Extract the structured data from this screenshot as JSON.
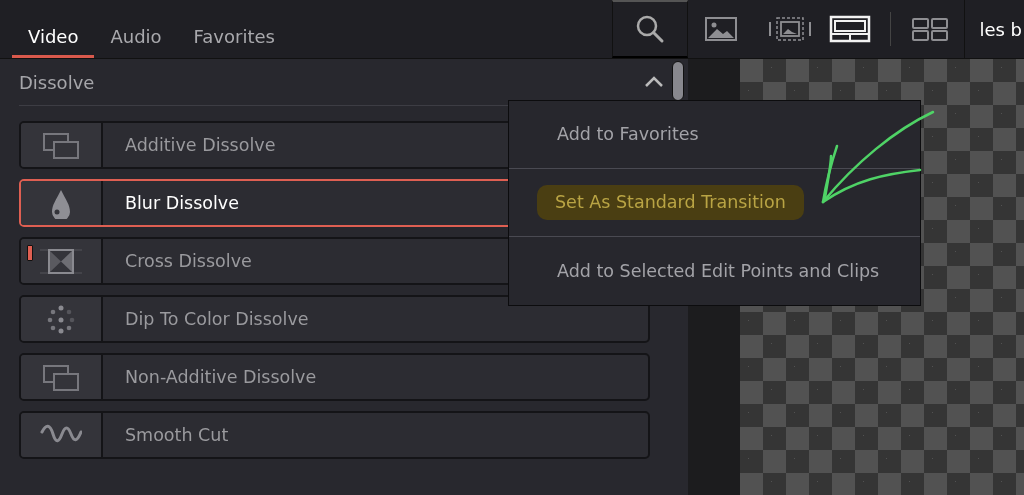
{
  "tabs": [
    {
      "label": "Video",
      "selected": true
    },
    {
      "label": "Audio",
      "selected": false
    },
    {
      "label": "Favorites",
      "selected": false
    }
  ],
  "view_toolbar": {
    "buttons": [
      {
        "kind": "image",
        "selected": false
      },
      {
        "kind": "image-strip",
        "selected": false
      },
      {
        "kind": "grid",
        "selected": true
      },
      {
        "kind": "tiles",
        "selected": false
      }
    ],
    "title": "les b"
  },
  "section": {
    "title": "Dissolve",
    "expanded": true
  },
  "transitions": [
    {
      "name": "Additive Dissolve",
      "kind": "overlap",
      "selected": false,
      "standard": false
    },
    {
      "name": "Blur Dissolve",
      "kind": "drop",
      "selected": true,
      "standard": false
    },
    {
      "name": "Cross Dissolve",
      "kind": "cross",
      "selected": false,
      "standard": true
    },
    {
      "name": "Dip To Color Dissolve",
      "kind": "dots",
      "selected": false,
      "standard": false
    },
    {
      "name": "Non-Additive Dissolve",
      "kind": "overlap",
      "selected": false,
      "standard": false
    },
    {
      "name": "Smooth Cut",
      "kind": "wave",
      "selected": false,
      "standard": false
    }
  ],
  "context_menu": {
    "items": [
      {
        "label": "Add to Favorites",
        "highlighted": false
      },
      {
        "label": "Set As Standard Transition",
        "highlighted": true
      },
      {
        "label": "Add to Selected Edit Points and Clips",
        "highlighted": false
      }
    ]
  }
}
